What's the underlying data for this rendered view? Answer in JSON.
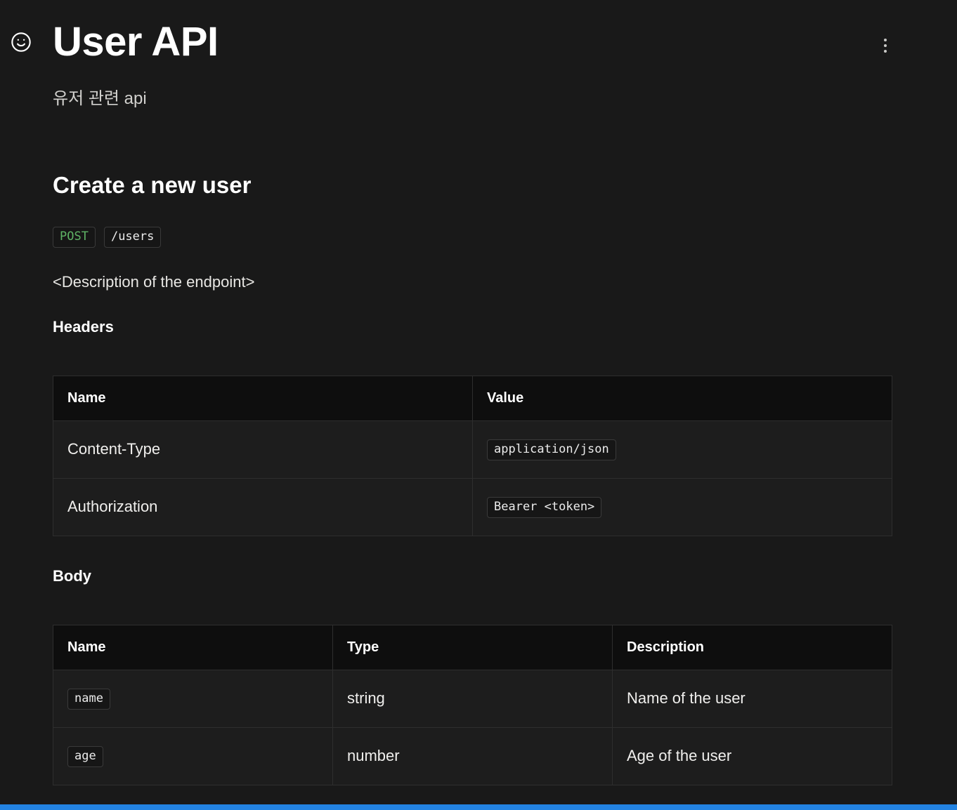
{
  "colors": {
    "method_green": "#5fb365",
    "accent_blue": "#2383e2",
    "background": "#191919",
    "table_header_bg": "#0e0e0e"
  },
  "page": {
    "icon": "smiley-face",
    "title": "User API",
    "subtitle": "유저 관련 api"
  },
  "endpoint": {
    "heading": "Create a new user",
    "method": "POST",
    "path": "/users",
    "description": "<Description of the endpoint>"
  },
  "headers_section": {
    "heading": "Headers",
    "columns": [
      "Name",
      "Value"
    ],
    "rows": [
      {
        "name": "Content-Type",
        "value": "application/json"
      },
      {
        "name": "Authorization",
        "value": "Bearer <token>"
      }
    ]
  },
  "body_section": {
    "heading": "Body",
    "columns": [
      "Name",
      "Type",
      "Description"
    ],
    "rows": [
      {
        "name": "name",
        "type": "string",
        "description": "Name of the user"
      },
      {
        "name": "age",
        "type": "number",
        "description": "Age of the user"
      }
    ]
  }
}
